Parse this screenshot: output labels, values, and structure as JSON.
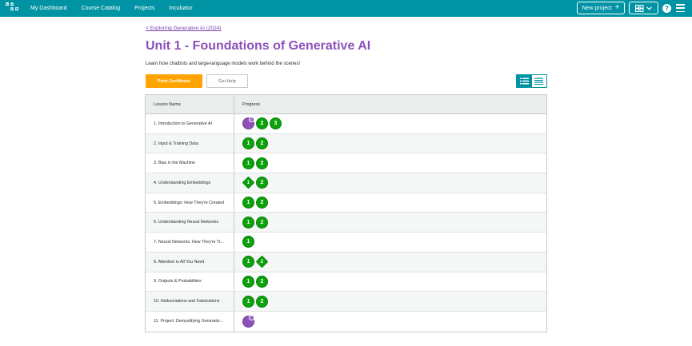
{
  "header": {
    "logo_letters": [
      "C",
      "O",
      "D",
      "E"
    ],
    "nav": [
      "My Dashboard",
      "Course Catalog",
      "Projects",
      "Incubator"
    ],
    "new_project": "New project",
    "help": "?",
    "brand_color": "#0093a4"
  },
  "breadcrumb": "< Exploring Generative AI (2024)",
  "page_title": "Unit 1 - Foundations of Generative AI",
  "description": "Learn how chatbots and large-language models work behind the scenes!",
  "buttons": {
    "print_certificate": "Print Certificate",
    "get_help": "Get Help"
  },
  "table": {
    "headers": [
      "Lesson Name",
      "Progress"
    ],
    "rows": [
      {
        "name": "1. Introduction to Generative AI",
        "bubbles": [
          {
            "t": "purple",
            "v": ""
          },
          {
            "t": "circle",
            "v": "2"
          },
          {
            "t": "circle",
            "v": "3"
          }
        ]
      },
      {
        "name": "2. Input & Training Data",
        "bubbles": [
          {
            "t": "circle",
            "v": "1"
          },
          {
            "t": "circle",
            "v": "2"
          }
        ]
      },
      {
        "name": "3. Bias in the Machine",
        "bubbles": [
          {
            "t": "circle",
            "v": "1"
          },
          {
            "t": "circle",
            "v": "2"
          }
        ]
      },
      {
        "name": "4. Understanding Embeddings",
        "bubbles": [
          {
            "t": "diamond",
            "v": "1"
          },
          {
            "t": "circle",
            "v": "2"
          }
        ]
      },
      {
        "name": "5. Embeddings: How They're Created",
        "bubbles": [
          {
            "t": "circle",
            "v": "1"
          },
          {
            "t": "circle",
            "v": "2"
          }
        ]
      },
      {
        "name": "6. Understanding Neural Networks",
        "bubbles": [
          {
            "t": "circle",
            "v": "1"
          },
          {
            "t": "circle",
            "v": "2"
          }
        ]
      },
      {
        "name": "7. Neural Networks: How They're Tr...",
        "bubbles": [
          {
            "t": "circle",
            "v": "1"
          }
        ]
      },
      {
        "name": "8. Attention is All You Need",
        "bubbles": [
          {
            "t": "circle",
            "v": "1"
          },
          {
            "t": "diamond",
            "v": "2"
          }
        ]
      },
      {
        "name": "9. Outputs & Probabilities",
        "bubbles": [
          {
            "t": "circle",
            "v": "1"
          },
          {
            "t": "circle",
            "v": "2"
          }
        ]
      },
      {
        "name": "10. Hallucinations and Fabrications",
        "bubbles": [
          {
            "t": "circle",
            "v": "1"
          },
          {
            "t": "circle",
            "v": "2"
          }
        ]
      },
      {
        "name": "11. Project: Demystifying Generativ...",
        "bubbles": [
          {
            "t": "purple",
            "v": ""
          }
        ]
      }
    ]
  }
}
